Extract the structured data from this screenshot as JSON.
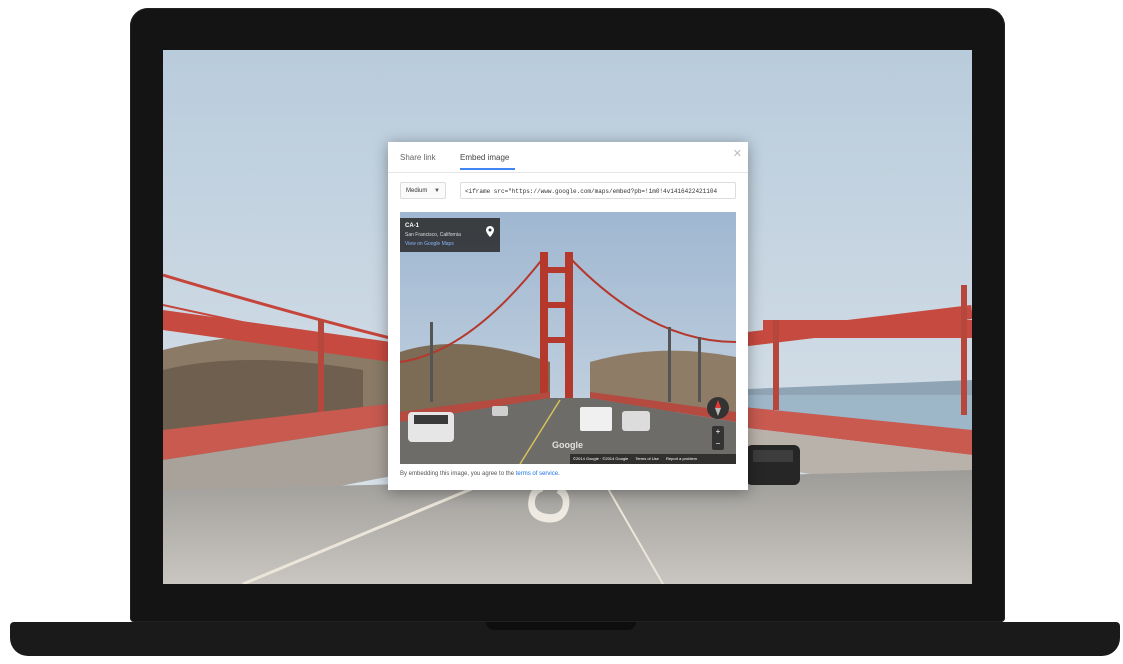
{
  "dialog": {
    "tabs": [
      {
        "label": "Share link",
        "active": false
      },
      {
        "label": "Embed image",
        "active": true
      }
    ],
    "close_icon": "close-icon",
    "size_select": {
      "value": "Medium"
    },
    "embed_code": "<iframe src=\"https://www.google.com/maps/embed?pb=!1m0!4v1416422421104",
    "preview": {
      "place_title": "CA-1",
      "place_subtitle": "San Francisco, California",
      "view_link": "View on Google Maps",
      "logo_text": "Google",
      "attribution": [
        "©2014 Google · ©2014 Google",
        "Terms of Use",
        "Report a problem"
      ]
    },
    "disclaimer_prefix": "By embedding this image, you agree to the ",
    "disclaimer_link": "terms of service",
    "disclaimer_suffix": "."
  },
  "road_text": "CA-1",
  "colors": {
    "accent": "#4285f4",
    "link": "#1a73e8",
    "bridge": "#c0392b"
  }
}
